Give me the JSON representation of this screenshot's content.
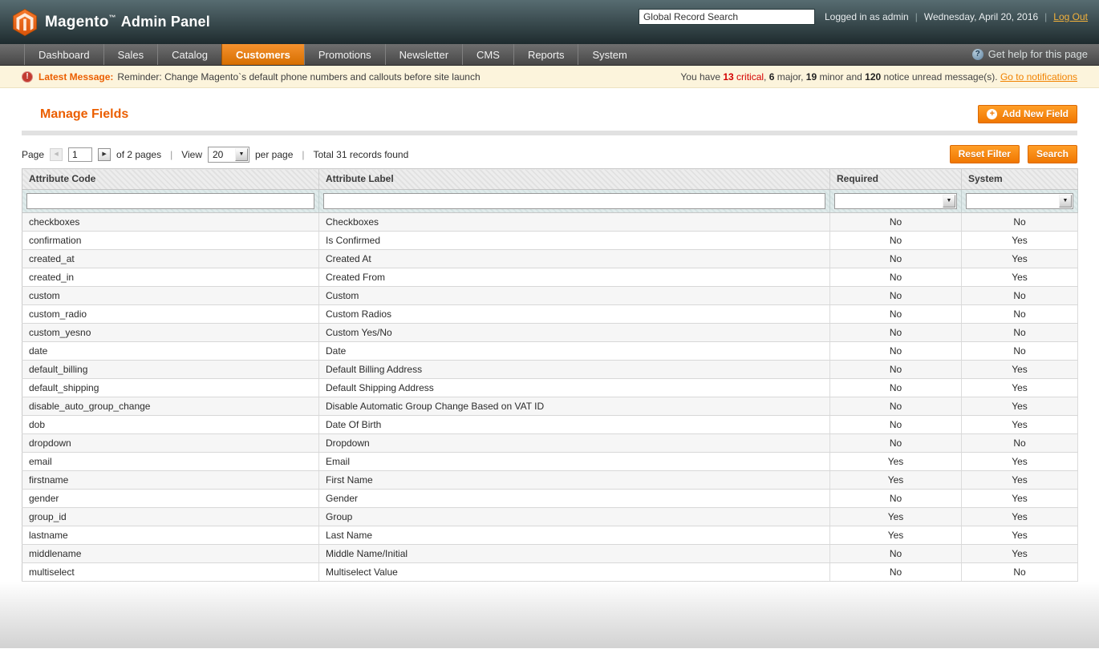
{
  "colors": {
    "accent_orange": "#eb5e00",
    "button_orange": "#f07701",
    "nav_active_orange": "#e87a10",
    "critical_red": "#d40000",
    "header_dark": "#1e2b2e",
    "message_bar_bg": "#fcf4dc",
    "link_gold": "#f2b13c"
  },
  "header": {
    "brand_name": "Magento",
    "brand_tm": "™",
    "brand_suffix": "Admin Panel",
    "search_value": "Global Record Search",
    "logged_in_text": "Logged in as admin",
    "separator": "|",
    "date_text": "Wednesday, April 20, 2016",
    "logout_label": "Log Out"
  },
  "nav": {
    "items": [
      {
        "label": "Dashboard",
        "active": false
      },
      {
        "label": "Sales",
        "active": false
      },
      {
        "label": "Catalog",
        "active": false
      },
      {
        "label": "Customers",
        "active": true
      },
      {
        "label": "Promotions",
        "active": false
      },
      {
        "label": "Newsletter",
        "active": false
      },
      {
        "label": "CMS",
        "active": false
      },
      {
        "label": "Reports",
        "active": false
      },
      {
        "label": "System",
        "active": false
      }
    ],
    "help_label": "Get help for this page"
  },
  "message_bar": {
    "label": "Latest Message:",
    "message": "Reminder: Change Magento`s default phone numbers and callouts before site launch",
    "summary": {
      "prefix": "You have ",
      "critical_num": "13",
      "critical_text": " critical",
      "sep_after_critical": ", ",
      "major_num": "6",
      "major_text": " major, ",
      "minor_num": "19",
      "minor_text": " minor and ",
      "notice_num": "120",
      "notice_text": " notice unread message(s). ",
      "link_label": "Go to notifications"
    }
  },
  "page": {
    "title": "Manage Fields",
    "add_button_label": "Add New Field"
  },
  "pager": {
    "page_label": "Page",
    "page_value": "1",
    "of_pages_text": "of 2 pages",
    "sep": "|",
    "view_label": "View",
    "per_page_value": "20",
    "per_page_text": "per page",
    "total_text": "Total 31 records found",
    "reset_label": "Reset Filter",
    "search_label": "Search"
  },
  "table": {
    "columns": [
      "Attribute Code",
      "Attribute Label",
      "Required",
      "System"
    ],
    "filter": {
      "code_value": "",
      "label_value": "",
      "required_value": "",
      "system_value": ""
    },
    "rows": [
      {
        "code": "checkboxes",
        "label": "Checkboxes",
        "required": "No",
        "system": "No"
      },
      {
        "code": "confirmation",
        "label": "Is Confirmed",
        "required": "No",
        "system": "Yes"
      },
      {
        "code": "created_at",
        "label": "Created At",
        "required": "No",
        "system": "Yes"
      },
      {
        "code": "created_in",
        "label": "Created From",
        "required": "No",
        "system": "Yes"
      },
      {
        "code": "custom",
        "label": "Custom",
        "required": "No",
        "system": "No"
      },
      {
        "code": "custom_radio",
        "label": "Custom Radios",
        "required": "No",
        "system": "No"
      },
      {
        "code": "custom_yesno",
        "label": "Custom Yes/No",
        "required": "No",
        "system": "No"
      },
      {
        "code": "date",
        "label": "Date",
        "required": "No",
        "system": "No"
      },
      {
        "code": "default_billing",
        "label": "Default Billing Address",
        "required": "No",
        "system": "Yes"
      },
      {
        "code": "default_shipping",
        "label": "Default Shipping Address",
        "required": "No",
        "system": "Yes"
      },
      {
        "code": "disable_auto_group_change",
        "label": "Disable Automatic Group Change Based on VAT ID",
        "required": "No",
        "system": "Yes"
      },
      {
        "code": "dob",
        "label": "Date Of Birth",
        "required": "No",
        "system": "Yes"
      },
      {
        "code": "dropdown",
        "label": "Dropdown",
        "required": "No",
        "system": "No"
      },
      {
        "code": "email",
        "label": "Email",
        "required": "Yes",
        "system": "Yes"
      },
      {
        "code": "firstname",
        "label": "First Name",
        "required": "Yes",
        "system": "Yes"
      },
      {
        "code": "gender",
        "label": "Gender",
        "required": "No",
        "system": "Yes"
      },
      {
        "code": "group_id",
        "label": "Group",
        "required": "Yes",
        "system": "Yes"
      },
      {
        "code": "lastname",
        "label": "Last Name",
        "required": "Yes",
        "system": "Yes"
      },
      {
        "code": "middlename",
        "label": "Middle Name/Initial",
        "required": "No",
        "system": "Yes"
      },
      {
        "code": "multiselect",
        "label": "Multiselect Value",
        "required": "No",
        "system": "No"
      }
    ]
  }
}
